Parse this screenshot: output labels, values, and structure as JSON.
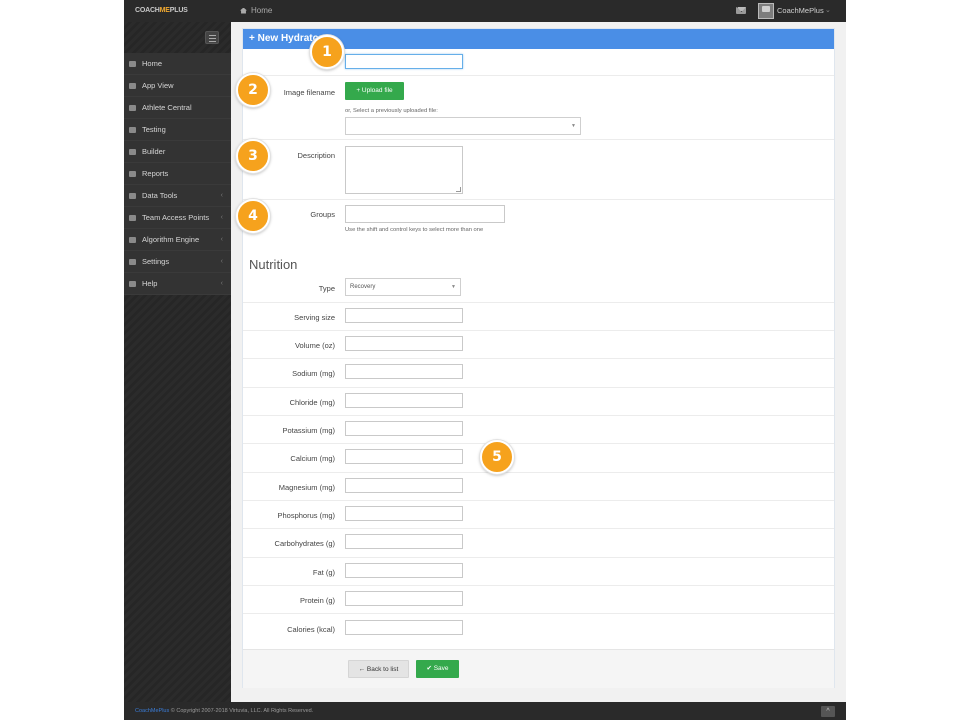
{
  "app": {
    "brand_prefix": "COACH",
    "brand_highlight": "ME",
    "brand_suffix": "PLUS"
  },
  "header": {
    "breadcrumb": "Home",
    "user_name": "CoachMePlus",
    "user_caret": "⌄"
  },
  "sidebar": {
    "items": [
      {
        "label": "Home",
        "icon": "home-icon",
        "has_children": false
      },
      {
        "label": "App View",
        "icon": "external-link-icon",
        "has_children": false
      },
      {
        "label": "Athlete Central",
        "icon": "users-icon",
        "has_children": false
      },
      {
        "label": "Testing",
        "icon": "edit-icon",
        "has_children": false
      },
      {
        "label": "Builder",
        "icon": "calendar-icon",
        "has_children": false
      },
      {
        "label": "Reports",
        "icon": "bar-chart-icon",
        "has_children": false
      },
      {
        "label": "Data Tools",
        "icon": "table-icon",
        "has_children": true
      },
      {
        "label": "Team Access Points",
        "icon": "clock-icon",
        "has_children": true
      },
      {
        "label": "Algorithm Engine",
        "icon": "key-icon",
        "has_children": true
      },
      {
        "label": "Settings",
        "icon": "gears-icon",
        "has_children": true
      },
      {
        "label": "Help",
        "icon": "question-circle-icon",
        "has_children": true
      }
    ],
    "chevron": "‹"
  },
  "panel": {
    "title": "+ New Hydrator"
  },
  "form": {
    "image_label": "Image filename",
    "upload_label": "+ Upload file",
    "select_uploaded_help": "or, Select a previously uploaded file:",
    "description_label": "Description",
    "groups_label": "Groups",
    "groups_help": "Use the shift and control keys to select more than one"
  },
  "nutrition": {
    "title": "Nutrition",
    "type_label": "Type",
    "type_value": "Recovery",
    "fields": [
      "Serving size",
      "Volume (oz)",
      "Sodium (mg)",
      "Chloride (mg)",
      "Potassium (mg)",
      "Calcium (mg)",
      "Magnesium (mg)",
      "Phosphorus (mg)",
      "Carbohydrates (g)",
      "Fat (g)",
      "Protein (g)",
      "Calories (kcal)"
    ]
  },
  "actions": {
    "back_label": "← Back to list",
    "save_label": "✔ Save"
  },
  "footer": {
    "link": "CoachMePlus",
    "text": " © Copyright 2007-2018 Virtuvia, LLC. All Rights Reserved.",
    "scroll_top": "^"
  },
  "markers": [
    "1",
    "2",
    "3",
    "4",
    "5"
  ],
  "colors": {
    "accent": "#4a8ee6",
    "success": "#34a94c",
    "marker": "#f6a21d",
    "sidebar": "#333333"
  }
}
